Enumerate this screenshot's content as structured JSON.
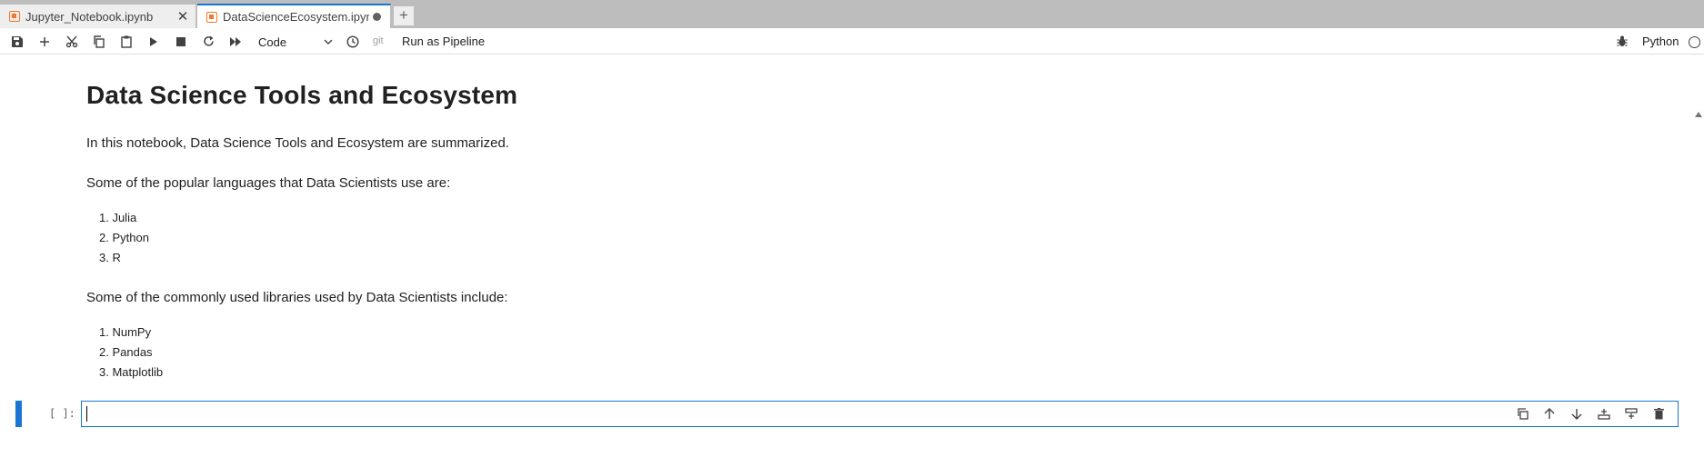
{
  "tabs": [
    {
      "label": "Jupyter_Notebook.ipynb",
      "close": "✕",
      "active": false
    },
    {
      "label": "DataScienceEcosystem.ipyn",
      "active": true
    }
  ],
  "add_tab": "+",
  "toolbar": {
    "cell_type": "Code",
    "git_label": "git",
    "pipeline_label": "Run as Pipeline",
    "kernel_name": "Python"
  },
  "notebook": {
    "title": "Data Science Tools and Ecosystem",
    "intro": "In this notebook, Data Science Tools and Ecosystem are summarized.",
    "languages_heading": "Some of the popular languages that Data Scientists use are:",
    "languages": [
      "1. Julia",
      "2. Python",
      "3. R"
    ],
    "libraries_heading": "Some of the commonly used libraries used by Data Scientists include:",
    "libraries": [
      "1. NumPy",
      "2. Pandas",
      "3. Matplotlib"
    ]
  },
  "code_cell": {
    "prompt": "[ ]:"
  },
  "colors": {
    "accent": "#1976d2",
    "notebook_icon": "#f37626"
  }
}
